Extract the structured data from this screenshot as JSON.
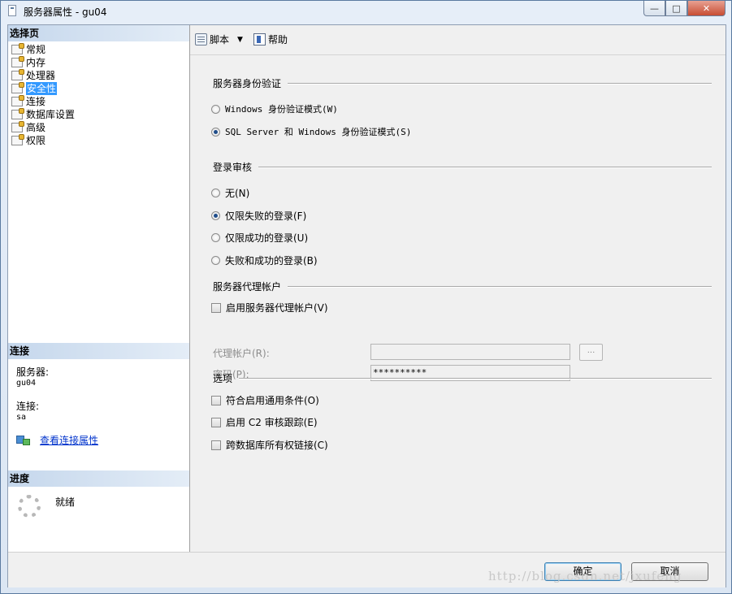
{
  "window": {
    "title": "服务器属性 - gu04",
    "minimize_glyph": "—",
    "maximize_glyph": "□",
    "close_glyph": "✕"
  },
  "left": {
    "pages_header": "选择页",
    "pages": [
      {
        "label": "常规",
        "selected": false
      },
      {
        "label": "内存",
        "selected": false
      },
      {
        "label": "处理器",
        "selected": false
      },
      {
        "label": "安全性",
        "selected": true
      },
      {
        "label": "连接",
        "selected": false
      },
      {
        "label": "数据库设置",
        "selected": false
      },
      {
        "label": "高级",
        "selected": false
      },
      {
        "label": "权限",
        "selected": false
      }
    ],
    "connection_header": "连接",
    "server_label": "服务器:",
    "server_value": "gu04",
    "connection_label": "连接:",
    "connection_value": "sa",
    "view_connection_link": "查看连接属性",
    "progress_header": "进度",
    "progress_status": "就绪"
  },
  "toolbar": {
    "script_label": "脚本",
    "help_label": "帮助",
    "dropdown_glyph": "▼"
  },
  "auth": {
    "title": "服务器身份验证",
    "windows_mode": "Windows 身份验证模式(W)",
    "mixed_mode": "SQL Server 和 Windows 身份验证模式(S)",
    "selected": "mixed"
  },
  "audit": {
    "title": "登录审核",
    "options": [
      {
        "label": "无(N)",
        "selected": false
      },
      {
        "label": "仅限失败的登录(F)",
        "selected": true
      },
      {
        "label": "仅限成功的登录(U)",
        "selected": false
      },
      {
        "label": "失败和成功的登录(B)",
        "selected": false
      }
    ]
  },
  "proxy": {
    "title": "服务器代理帐户",
    "enable_label": "启用服务器代理帐户(V)",
    "enabled": false,
    "account_label": "代理帐户(R):",
    "account_value": "",
    "password_label": "密码(P):",
    "password_value": "**********",
    "browse_label": "..."
  },
  "options": {
    "title": "选项",
    "items": [
      {
        "label": "符合启用通用条件(O)",
        "checked": false
      },
      {
        "label": "启用 C2 审核跟踪(E)",
        "checked": false
      },
      {
        "label": "跨数据库所有权链接(C)",
        "checked": false
      }
    ]
  },
  "buttons": {
    "ok": "确定",
    "cancel": "取消"
  },
  "watermark": "http://blog.csdn.net/jxufeng"
}
